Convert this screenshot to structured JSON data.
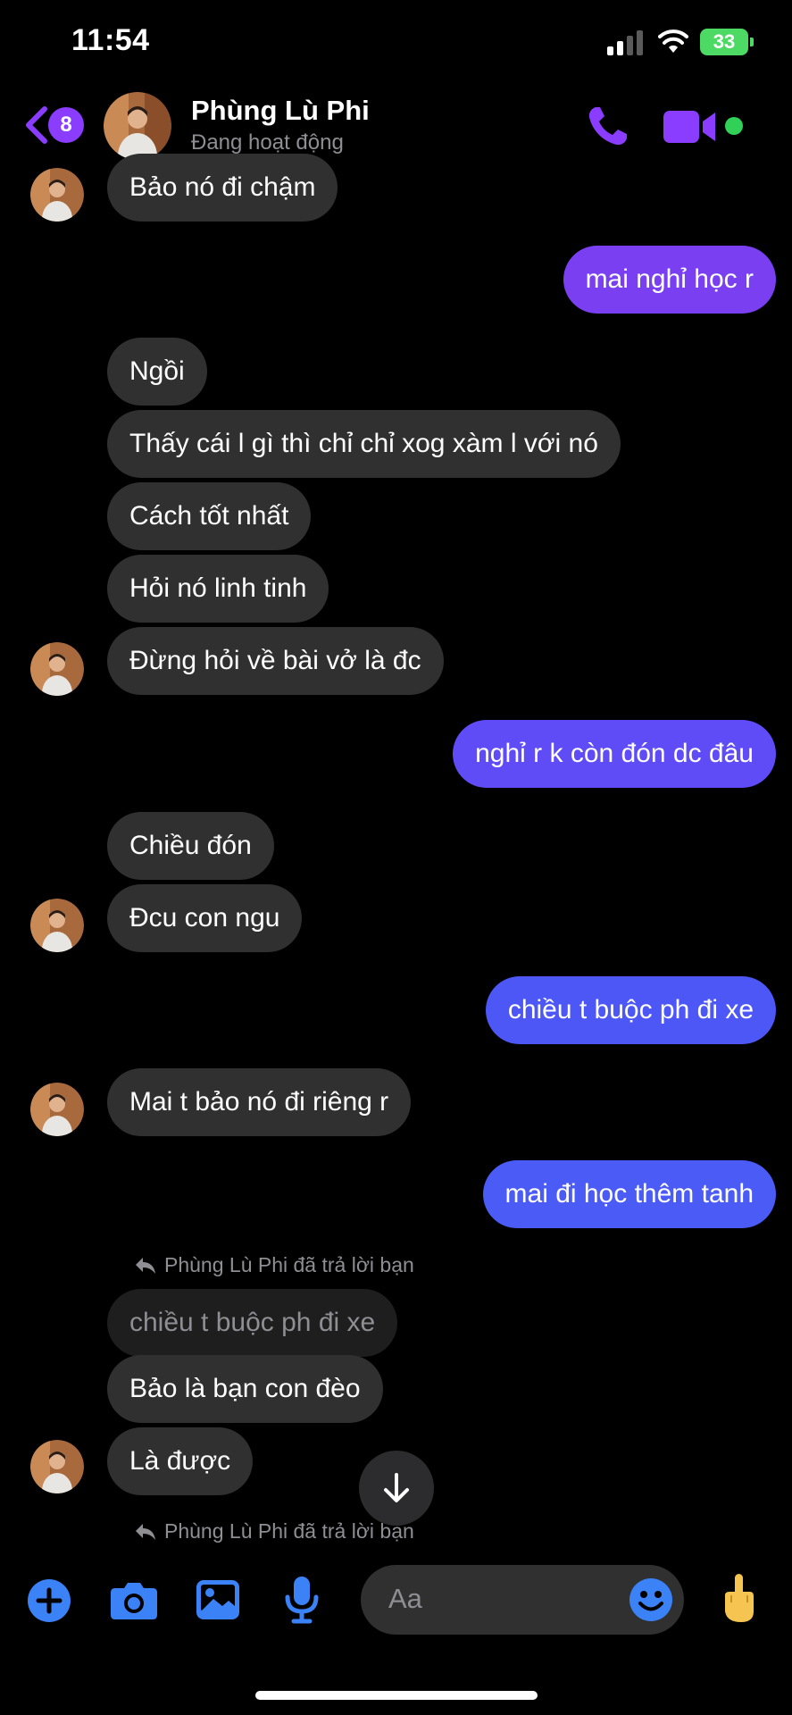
{
  "status_bar": {
    "time": "11:54",
    "battery": "33"
  },
  "header": {
    "unread_count": "8",
    "contact_name": "Phùng Lù Phi",
    "contact_status": "Đang hoạt động"
  },
  "messages": [
    {
      "dir": "in",
      "text": "Bảo nó đi chậm"
    },
    {
      "dir": "out",
      "text": "mai nghỉ học r"
    },
    {
      "dir": "in",
      "text": "Ngồi"
    },
    {
      "dir": "in",
      "text": "Thấy cái l gì thì chỉ chỉ xog xàm l với nó"
    },
    {
      "dir": "in",
      "text": "Cách tốt nhất"
    },
    {
      "dir": "in",
      "text": "Hỏi nó linh tinh"
    },
    {
      "dir": "in",
      "text": "Đừng hỏi về bài vở là đc"
    },
    {
      "dir": "out",
      "text": "nghỉ r k còn đón dc đâu"
    },
    {
      "dir": "in",
      "text": "Chiều đón"
    },
    {
      "dir": "in",
      "text": "Đcu con ngu"
    },
    {
      "dir": "out",
      "text": "chiều t buộc ph đi xe"
    },
    {
      "dir": "in",
      "text": "Mai t bảo nó đi riêng r"
    },
    {
      "dir": "out",
      "text": "mai đi học thêm tanh"
    },
    {
      "dir": "in",
      "text": "Bảo là bạn con đèo"
    },
    {
      "dir": "in",
      "text": "Là được"
    }
  ],
  "reply_notes": [
    {
      "text": "Phùng Lù Phi đã trả lời bạn",
      "quoted": "chiều t buộc ph đi xe"
    },
    {
      "text": "Phùng Lù Phi đã trả lời bạn"
    }
  ],
  "composer": {
    "placeholder": "Aa"
  },
  "colors": {
    "accent": "#8b3dff",
    "incoming_bubble": "#303030",
    "outgoing_purple": "#7b3ff2",
    "outgoing_blue": "#4a5cf5"
  },
  "icons": [
    "plus-icon",
    "camera-icon",
    "image-icon",
    "microphone-icon",
    "emoji-icon",
    "hand-emoji-icon",
    "phone-icon",
    "video-icon"
  ]
}
